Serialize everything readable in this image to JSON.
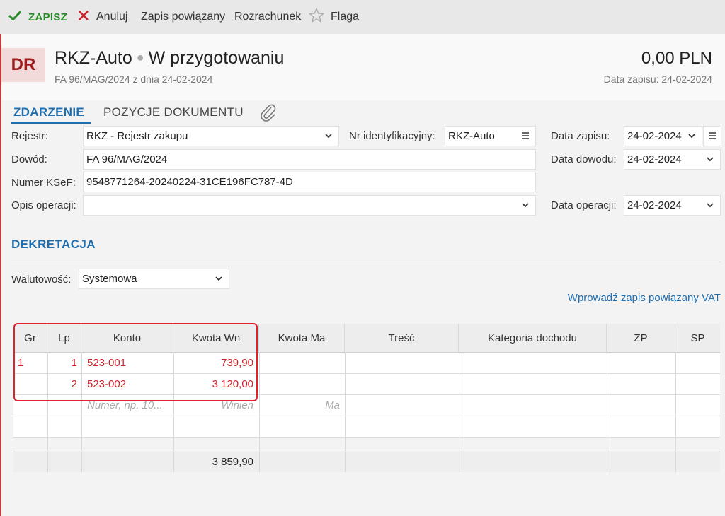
{
  "toolbar": {
    "save_label": "ZAPISZ",
    "cancel_label": "Anuluj",
    "linked_label": "Zapis powiązany",
    "settlement_label": "Rozrachunek",
    "flag_label": "Flaga"
  },
  "header": {
    "badge": "DR",
    "title": "RKZ-Auto",
    "status": "W przygotowaniu",
    "subtitle": "FA 96/MAG/2024 z dnia 24-02-2024",
    "amount": "0,00 PLN",
    "entry_date": "Data zapisu: 24-02-2024"
  },
  "tabs": [
    {
      "label": "ZDARZENIE",
      "active": true
    },
    {
      "label": "POZYCJE DOKUMENTU",
      "active": false
    }
  ],
  "form": {
    "register_label": "Rejestr:",
    "register_value": "RKZ - Rejestr zakupu",
    "id_number_label": "Nr identyfikacyjny:",
    "id_number_value": "RKZ-Auto",
    "entry_date_label": "Data zapisu:",
    "entry_date_value": "24-02-2024",
    "proof_label": "Dowód:",
    "proof_value": "FA 96/MAG/2024",
    "proof_date_label": "Data dowodu:",
    "proof_date_value": "24-02-2024",
    "ksef_label": "Numer KSeF:",
    "ksef_value": "9548771264-20240224-31CE196FC787-4D",
    "operation_desc_label": "Opis operacji:",
    "operation_desc_value": "",
    "operation_date_label": "Data operacji:",
    "operation_date_value": "24-02-2024"
  },
  "decree": {
    "section_title": "DEKRETACJA",
    "currency_label": "Walutowość:",
    "currency_value": "Systemowa",
    "vat_link": "Wprowadź zapis powiązany VAT",
    "columns": [
      "Gr",
      "Lp",
      "Konto",
      "Kwota Wn",
      "Kwota Ma",
      "Treść",
      "Kategoria dochodu",
      "ZP",
      "SP"
    ],
    "rows": [
      {
        "gr": "1",
        "lp": "1",
        "konto": "523-001",
        "wn": "739,90",
        "ma": ""
      },
      {
        "gr": "",
        "lp": "2",
        "konto": "523-002",
        "wn": "3 120,00",
        "ma": ""
      }
    ],
    "new_row_placeholders": {
      "konto": "Numer, np. 10...",
      "wn": "Winien",
      "ma": "Ma"
    },
    "total_wn": "3 859,90"
  },
  "colors": {
    "accent": "#1f6fb0",
    "save": "#2a8a2a",
    "cancel": "#d0202a",
    "amount_red": "#d0202a",
    "badge_bg": "#f3dada"
  }
}
